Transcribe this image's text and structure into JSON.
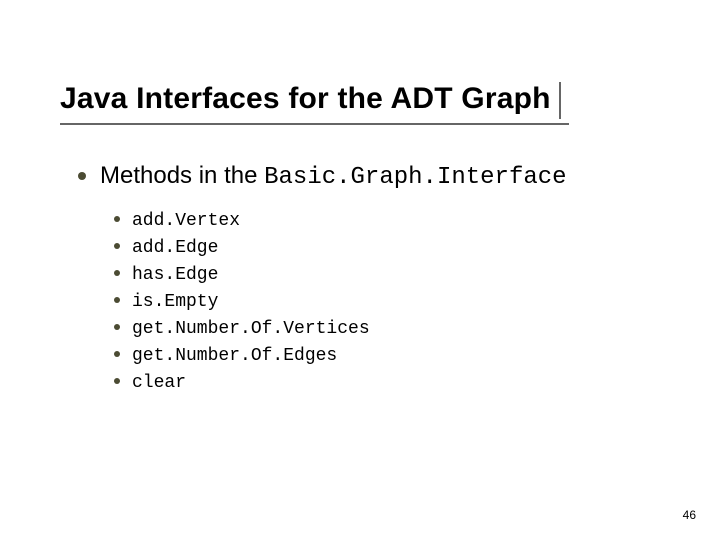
{
  "title": "Java Interfaces for the ADT Graph",
  "main": {
    "lead": "Methods in the ",
    "lead_code": "Basic.Graph.Interface"
  },
  "methods": [
    "add.Vertex",
    "add.Edge",
    "has.Edge",
    "is.Empty",
    "get.Number.Of.Vertices",
    "get.Number.Of.Edges",
    "clear"
  ],
  "page_number": "46"
}
